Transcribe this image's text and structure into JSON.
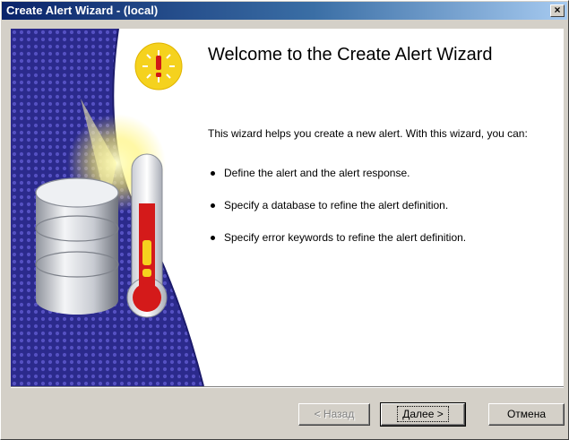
{
  "window": {
    "title": "Create Alert Wizard - (local)",
    "close_label": "×"
  },
  "main": {
    "heading": "Welcome to the Create Alert Wizard",
    "intro": "This wizard helps you create a new alert. With this wizard, you can:",
    "bullets": [
      "Define the alert and the alert response.",
      "Specify a database to refine the alert definition.",
      "Specify error keywords to refine the alert definition."
    ]
  },
  "buttons": {
    "back": "< Назад",
    "next": "Далее >",
    "cancel": "Отмена"
  },
  "icons": {
    "sidebar_art": "database-thermometer-alert-icon",
    "badge": "exclamation-sun-icon"
  },
  "colors": {
    "title_bar": "#0a246a",
    "art_blue": "#2b2a8c",
    "thermometer_red": "#d41a1a",
    "badge_yellow": "#f5d21e"
  }
}
